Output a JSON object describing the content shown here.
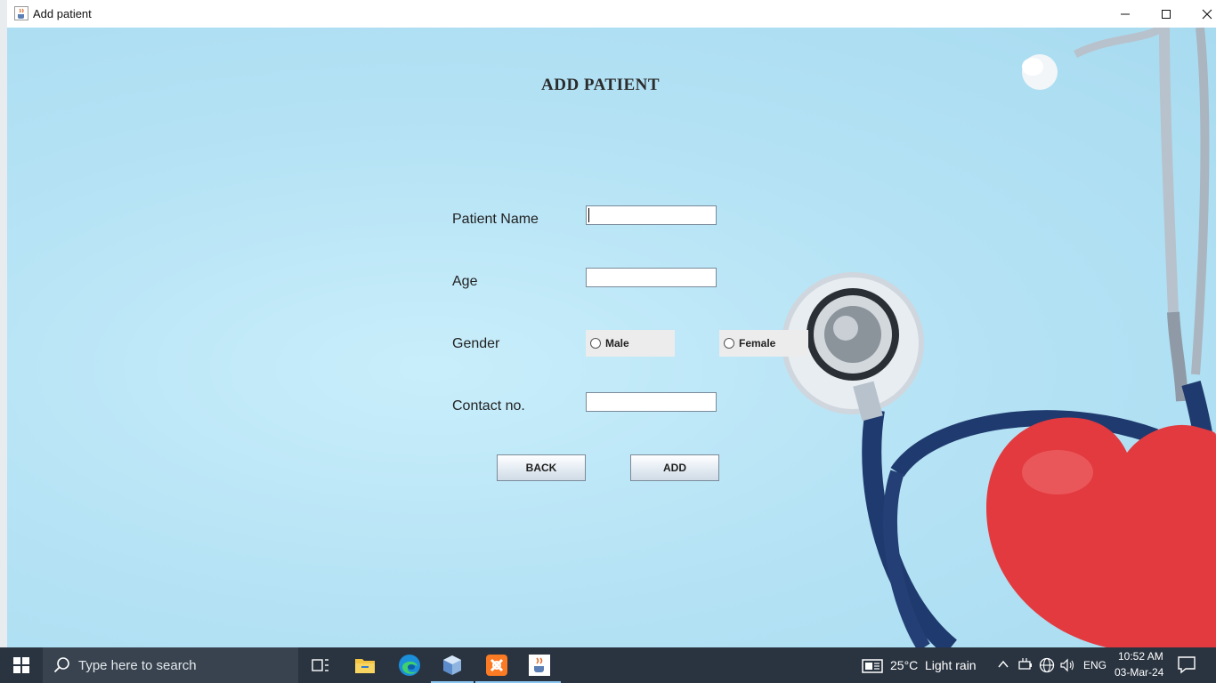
{
  "window": {
    "title": "Add patient",
    "app_icon": "java-cup-icon",
    "controls": [
      "minimize-icon",
      "maximize-icon",
      "close-icon"
    ]
  },
  "form": {
    "heading": "ADD PATIENT",
    "fields": {
      "patient_name": {
        "label": "Patient Name",
        "value": ""
      },
      "age": {
        "label": "Age",
        "value": ""
      },
      "gender": {
        "label": "Gender",
        "options": [
          "Male",
          "Female"
        ],
        "selected": null
      },
      "contact": {
        "label": "Contact no.",
        "value": ""
      }
    },
    "buttons": {
      "back": "BACK",
      "add": "ADD"
    }
  },
  "colors": {
    "background": "#b6e3f5",
    "taskbar": "#2a3440",
    "heart": "#e23a3f",
    "stethoscope_tube": "#1f3a6e"
  },
  "taskbar": {
    "search_placeholder": "Type here to search",
    "pinned": [
      "task-view-icon",
      "file-explorer-icon",
      "edge-icon",
      "virtualbox-icon",
      "xampp-icon",
      "java-icon"
    ],
    "weather": {
      "temp": "25°C",
      "desc": "Light rain"
    },
    "language": "ENG",
    "time": "10:52 AM",
    "date": "03-Mar-24"
  }
}
